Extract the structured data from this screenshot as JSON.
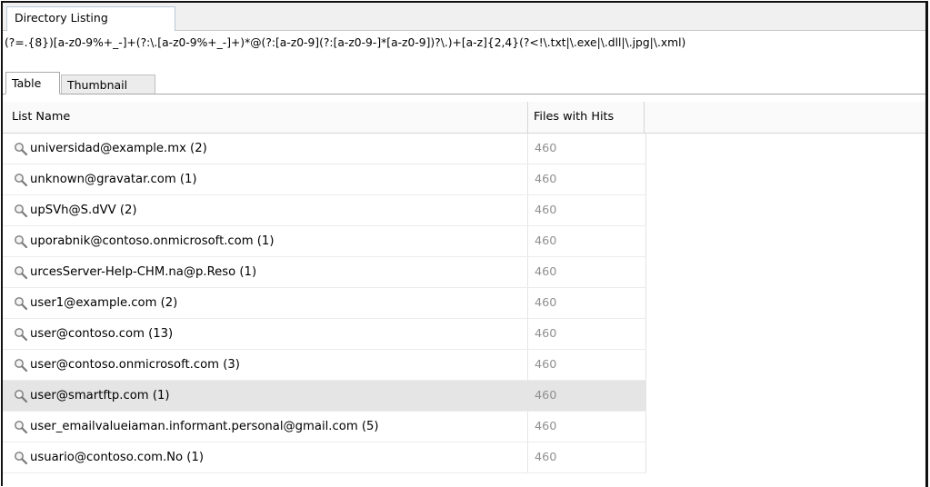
{
  "window": {
    "tab_title": "Directory Listing",
    "filter_expression": "(?=.{8})[a-z0-9%+_-]+(?:\\.[a-z0-9%+_-]+)*@(?:[a-z0-9](?:[a-z0-9-]*[a-z0-9])?\\.)+[a-z]{2,4}(?<!\\.txt|\\.exe|\\.dll|\\.jpg|\\.xml)"
  },
  "view_tabs": [
    {
      "label": "Table",
      "active": true
    },
    {
      "label": "Thumbnail",
      "active": false
    }
  ],
  "table": {
    "columns": [
      "List Name",
      "Files with Hits"
    ],
    "rows": [
      {
        "name": "universidad@example.mx (2)",
        "hits": "460",
        "icon": "search-icon",
        "selected": false
      },
      {
        "name": "unknown@gravatar.com (1)",
        "hits": "460",
        "icon": "search-icon",
        "selected": false
      },
      {
        "name": "upSVh@S.dVV (2)",
        "hits": "460",
        "icon": "search-icon",
        "selected": false
      },
      {
        "name": "uporabnik@contoso.onmicrosoft.com (1)",
        "hits": "460",
        "icon": "search-icon",
        "selected": false
      },
      {
        "name": "urcesServer-Help-CHM.na@p.Reso (1)",
        "hits": "460",
        "icon": "search-icon",
        "selected": false
      },
      {
        "name": "user1@example.com (2)",
        "hits": "460",
        "icon": "search-icon",
        "selected": false
      },
      {
        "name": "user@contoso.com (13)",
        "hits": "460",
        "icon": "search-icon",
        "selected": false
      },
      {
        "name": "user@contoso.onmicrosoft.com (3)",
        "hits": "460",
        "icon": "search-icon",
        "selected": false
      },
      {
        "name": "user@smartftp.com (1)",
        "hits": "460",
        "icon": "search-icon",
        "selected": true
      },
      {
        "name": "user_emailvalueiaman.informant.personal@gmail.com (5)",
        "hits": "460",
        "icon": "search-icon",
        "selected": false
      },
      {
        "name": "usuario@contoso.com.No (1)",
        "hits": "460",
        "icon": "search-icon",
        "selected": false
      }
    ]
  },
  "colors": {
    "selected_row": "#e5e5e5",
    "hits_text": "#909090",
    "frame": "#111111"
  }
}
